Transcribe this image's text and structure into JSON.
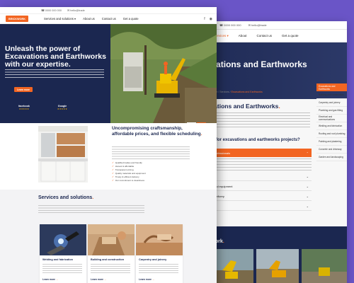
{
  "colors": {
    "brand": "#f26522",
    "navy": "#1b2750",
    "backdrop": "#6a55c7"
  },
  "back_page": {
    "topbar": [
      "☎ 0000 000 000",
      "✉ hello@trade"
    ],
    "nav": {
      "services": "Services ▾",
      "about": "About",
      "contact": "Contact us",
      "quote": "Get a quote"
    },
    "hero_title": "cavations and Earthworks",
    "breadcrumb_prefix": "Home / Services / ",
    "breadcrumb_current": "Excavations and Earthworks",
    "heading": "cavations and Earthworks",
    "heading_dot": ".",
    "why_heading": "se us for excavations and earthworks projects?",
    "accordion": [
      {
        "label": "tified professionals",
        "open": true
      },
      {
        "label": "pricing",
        "open": false
      },
      {
        "label": "ment and equipment",
        "open": false
      },
      {
        "label": "ready delivery",
        "open": false
      },
      {
        "label": "rranty",
        "open": false
      }
    ],
    "sidebar": [
      "Excavations and Earthworks",
      "Building and construction",
      "Carpentry and joinery",
      "Plumbing and gas fitting",
      "Electrical and communications",
      "Welding and fabrication",
      "Roofing and roof plumbing",
      "Painting and plastering",
      "Concrete and driveway",
      "Garden and landscaping"
    ],
    "recent_work_title": "ent work",
    "recent_work_dot": "."
  },
  "front_page": {
    "topbar": [
      "☎ 0000 000 000",
      "✉ hello@trade"
    ],
    "logo_text": "BRICKWORK",
    "nav": [
      "Services and solutions ▾",
      "About us",
      "Contact us",
      "Get a quote"
    ],
    "nav_icons": [
      "f",
      "◉"
    ],
    "hero": {
      "title": "Unleash the power of Excavations and Earthworks with our expertise.",
      "cta": "Learn more",
      "badges": [
        {
          "name": "facebook",
          "stars": "★★★★★"
        },
        {
          "name": "Google",
          "stars": "★★★★★"
        }
      ],
      "prev": "‹",
      "next": "›"
    },
    "about": {
      "title": "Uncompromising craftsmanship, affordable prices, and flexible scheduling",
      "title_dot": ".",
      "checklist": [
        "Qualified tradies and friendly",
        "Honest & affordable",
        "Transparent pricing",
        "Quality materials and equipment",
        "Timely & efficient delivery",
        "Our commitment to cleanliness"
      ]
    },
    "services": {
      "title": "Services and solutions",
      "title_dot": ".",
      "cards": [
        {
          "title": "Welding and fabrication",
          "link": "Learn more"
        },
        {
          "title": "Building and construction",
          "link": "Learn more"
        },
        {
          "title": "Carpentry and joinery",
          "link": "Learn more"
        }
      ]
    }
  }
}
